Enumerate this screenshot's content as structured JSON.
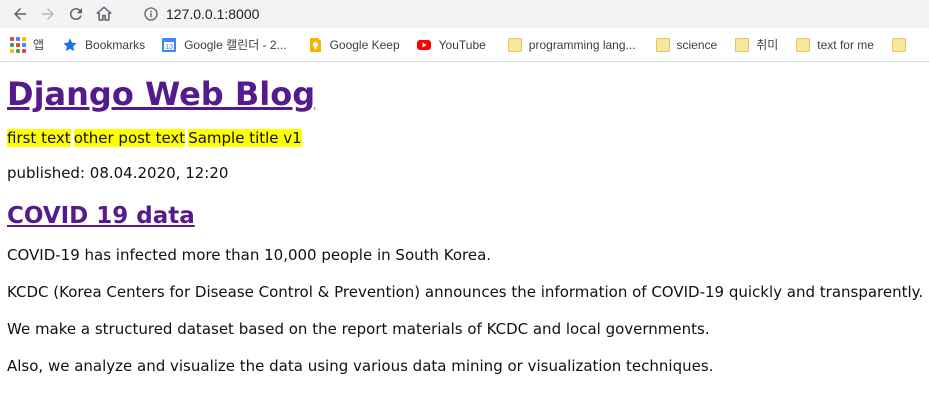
{
  "browser": {
    "url": "127.0.0.1:8000",
    "bookmarks": [
      {
        "label": "앱",
        "icon": "apps-icon"
      },
      {
        "label": "Bookmarks",
        "icon": "star-icon"
      },
      {
        "label": "Google 캘린더 - 2...",
        "icon": "calendar-icon"
      },
      {
        "label": "Google Keep",
        "icon": "keep-icon"
      },
      {
        "label": "YouTube",
        "icon": "youtube-icon"
      },
      {
        "label": "programming lang...",
        "icon": "folder-icon"
      },
      {
        "label": "science",
        "icon": "folder-icon"
      },
      {
        "label": "취미",
        "icon": "folder-icon"
      },
      {
        "label": "text for me",
        "icon": "folder-icon"
      }
    ]
  },
  "page": {
    "title": "Django Web Blog",
    "post_links": [
      "first text",
      "other post text",
      "Sample title v1"
    ],
    "published": "published: 08.04.2020, 12:20",
    "post": {
      "title": "COVID 19 data",
      "paragraphs": [
        "COVID-19 has infected more than 10,000 people in South Korea.",
        "KCDC (Korea Centers for Disease Control & Prevention) announces the information of COVID-19 quickly and transparently.",
        "We make a structured dataset based on the report materials of KCDC and local governments.",
        "Also, we analyze and visualize the data using various data mining or visualization techniques."
      ]
    }
  },
  "colors": {
    "link_visited": "#551a8b",
    "highlight": "#ffff00",
    "chrome_bg": "#f1f3f4"
  }
}
